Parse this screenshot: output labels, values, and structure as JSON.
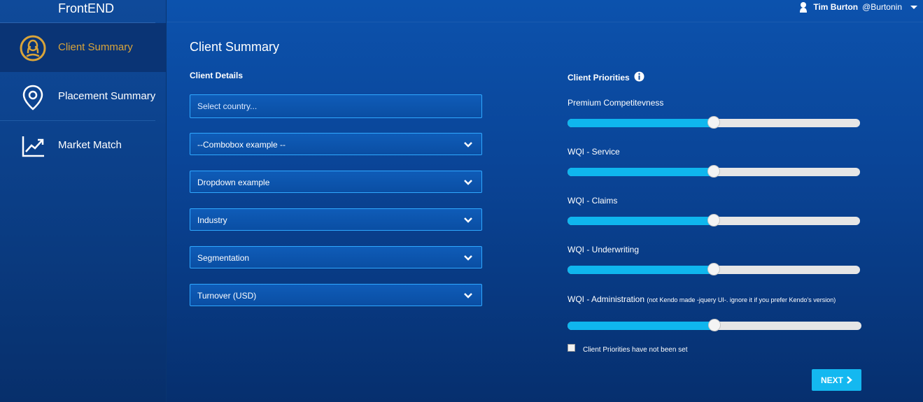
{
  "app": {
    "brand": "FrontEND"
  },
  "sidebar": {
    "items": [
      {
        "label": "Client Summary",
        "icon": "user-circle-icon",
        "active": true
      },
      {
        "label": "Placement Summary",
        "icon": "map-pin-icon",
        "active": false
      },
      {
        "label": "Market Match",
        "icon": "line-chart-icon",
        "active": false
      }
    ]
  },
  "user": {
    "name": "Tim Burton",
    "handle": "@Burtonin"
  },
  "page": {
    "title": "Client Summary"
  },
  "client_details": {
    "title": "Client Details",
    "country_placeholder": "Select country...",
    "fields": [
      "--Combobox example --",
      "Dropdown example",
      "Industry",
      "Segmentation",
      "Turnover (USD)"
    ]
  },
  "client_priorities": {
    "title": "Client Priorities",
    "sliders": [
      {
        "label": "Premium Competitevness",
        "value": 0.5
      },
      {
        "label": "WQI - Service",
        "value": 0.5
      },
      {
        "label": "WQI - Claims",
        "value": 0.5
      },
      {
        "label": "WQI - Underwriting",
        "value": 0.5
      },
      {
        "label": "WQI - Administration",
        "note": "(not Kendo made -jquery UI-. ignore it if you prefer Kendo's version)",
        "value": 0.5
      }
    ],
    "checkbox_label": "Client Priorities have not been set",
    "checkbox_checked": false
  },
  "actions": {
    "next_label": "NEXT"
  },
  "colors": {
    "accent": "#14b8f0",
    "active_nav_text": "#d9a43a",
    "slider_fill": "#0fb6ee"
  }
}
